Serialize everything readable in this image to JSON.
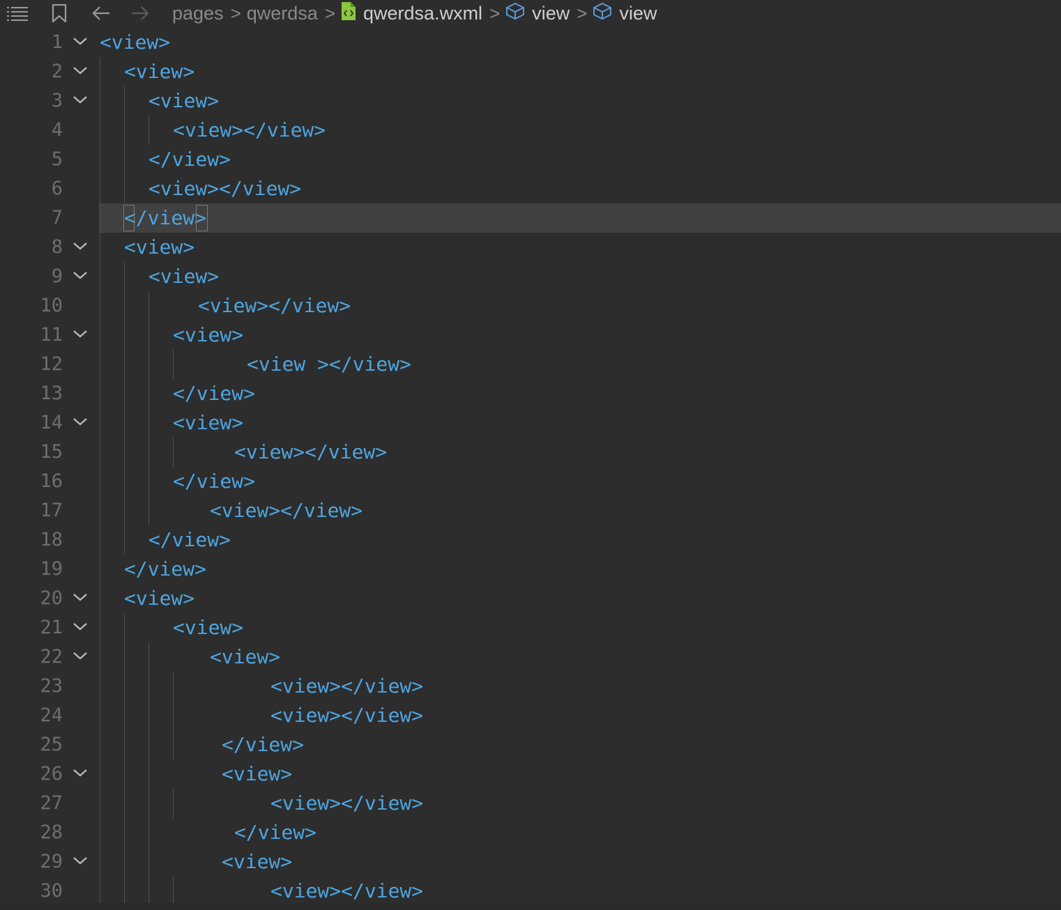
{
  "toolbar": {
    "outline_icon": "list-icon",
    "bookmark_icon": "bookmark-icon",
    "back_icon": "arrow-left-icon",
    "forward_icon": "arrow-right-icon"
  },
  "breadcrumb": {
    "items": [
      "pages",
      "qwerdsa",
      "qwerdsa.wxml",
      "view",
      "view"
    ],
    "separator": ">"
  },
  "colors": {
    "background": "#2d2d2d",
    "tag": "#4da5e0",
    "line_number": "#6e6e6e",
    "current_line": "#414141",
    "file_icon": "#8dc63f",
    "symbol_icon": "#5a9bd5"
  },
  "editor": {
    "current_line": 7,
    "lines": [
      {
        "n": "1",
        "text": "<view>",
        "fold": true
      },
      {
        "n": "2",
        "text": "<view>",
        "fold": true
      },
      {
        "n": "3",
        "text": "<view>",
        "fold": true
      },
      {
        "n": "4",
        "text": "<view></view>",
        "fold": false
      },
      {
        "n": "5",
        "text": "</view>",
        "fold": false
      },
      {
        "n": "6",
        "text": "<view></view>",
        "fold": false
      },
      {
        "n": "7",
        "text": "</view>",
        "fold": false
      },
      {
        "n": "8",
        "text": "<view>",
        "fold": true
      },
      {
        "n": "9",
        "text": "<view>",
        "fold": true
      },
      {
        "n": "10",
        "text": "<view></view>",
        "fold": false
      },
      {
        "n": "11",
        "text": "<view>",
        "fold": true
      },
      {
        "n": "12",
        "text": "<view ></view>",
        "fold": false
      },
      {
        "n": "13",
        "text": "</view>",
        "fold": false
      },
      {
        "n": "14",
        "text": "<view>",
        "fold": true
      },
      {
        "n": "15",
        "text": "<view></view>",
        "fold": false
      },
      {
        "n": "16",
        "text": "</view>",
        "fold": false
      },
      {
        "n": "17",
        "text": "<view></view>",
        "fold": false
      },
      {
        "n": "18",
        "text": "</view>",
        "fold": false
      },
      {
        "n": "19",
        "text": "</view>",
        "fold": false
      },
      {
        "n": "20",
        "text": "<view>",
        "fold": true
      },
      {
        "n": "21",
        "text": "<view>",
        "fold": true
      },
      {
        "n": "22",
        "text": "<view>",
        "fold": true
      },
      {
        "n": "23",
        "text": "<view></view>",
        "fold": false
      },
      {
        "n": "24",
        "text": "<view></view>",
        "fold": false
      },
      {
        "n": "25",
        "text": "</view>",
        "fold": false
      },
      {
        "n": "26",
        "text": "<view>",
        "fold": true
      },
      {
        "n": "27",
        "text": "<view></view>",
        "fold": false
      },
      {
        "n": "28",
        "text": "</view>",
        "fold": false
      },
      {
        "n": "29",
        "text": "<view>",
        "fold": true
      },
      {
        "n": "30",
        "text": "<view></view>",
        "fold": false
      }
    ]
  }
}
